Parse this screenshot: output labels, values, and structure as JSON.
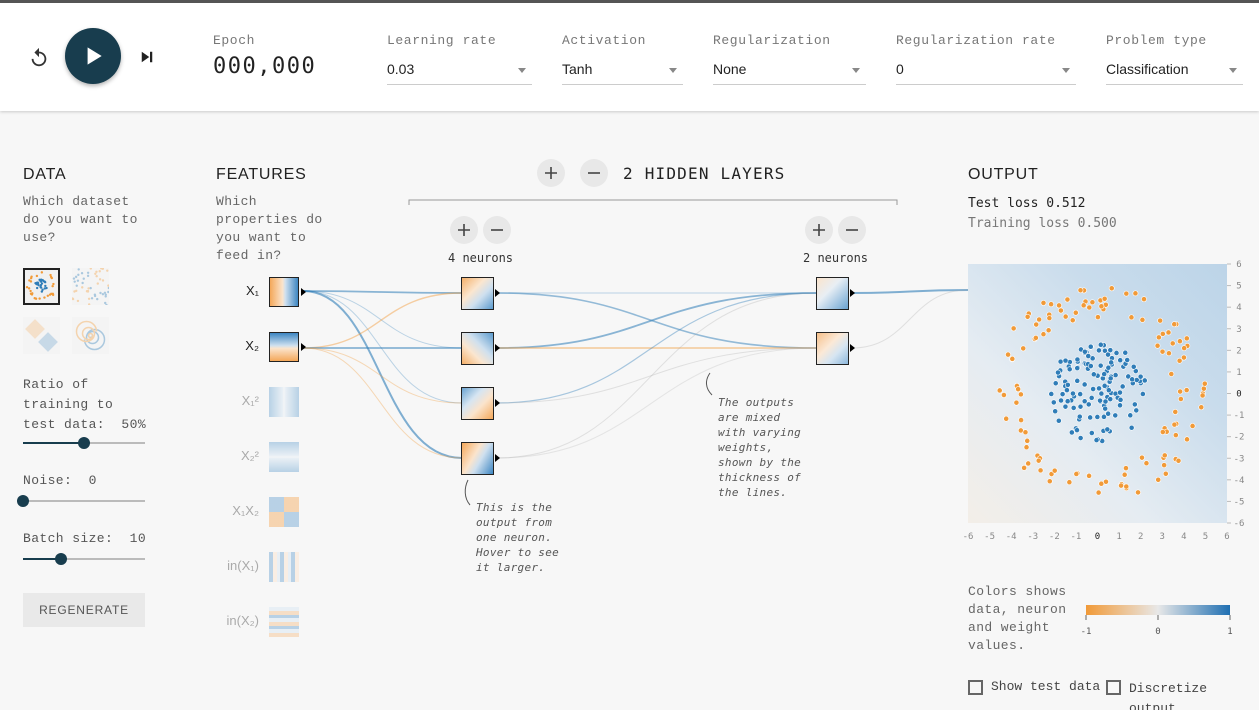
{
  "toolbar": {
    "epoch_label": "Epoch",
    "epoch_value": "000,000",
    "learning_rate": {
      "label": "Learning rate",
      "value": "0.03"
    },
    "activation": {
      "label": "Activation",
      "value": "Tanh"
    },
    "regularization": {
      "label": "Regularization",
      "value": "None"
    },
    "regularization_rate": {
      "label": "Regularization rate",
      "value": "0"
    },
    "problem_type": {
      "label": "Problem type",
      "value": "Classification"
    },
    "icons": {
      "reset": "reset-icon",
      "play": "play-icon",
      "step": "step-forward-icon"
    }
  },
  "data_panel": {
    "title": "DATA",
    "description": "Which dataset do you want to use?",
    "datasets": [
      "circle",
      "xor",
      "gaussian",
      "spiral"
    ],
    "selected_dataset": "circle",
    "ratio": {
      "label": "Ratio of training to test data:",
      "value": "50%",
      "fraction": 0.5
    },
    "noise": {
      "label": "Noise:",
      "value": "0",
      "fraction": 0.0
    },
    "batch": {
      "label": "Batch size:",
      "value": "10",
      "fraction": 0.31
    },
    "regenerate_label": "REGENERATE"
  },
  "features_panel": {
    "title": "FEATURES",
    "description": "Which properties do you want to feed in?",
    "features": [
      {
        "label": "X₁",
        "active": true
      },
      {
        "label": "X₂",
        "active": true
      },
      {
        "label": "X₁²",
        "active": false
      },
      {
        "label": "X₂²",
        "active": false
      },
      {
        "label": "X₁X₂",
        "active": false
      },
      {
        "label": "in(X₁)",
        "active": false
      },
      {
        "label": "in(X₂)",
        "active": false
      }
    ]
  },
  "network": {
    "hidden_layers_count": "2",
    "hidden_layers_label": "HIDDEN LAYERS",
    "layers": [
      {
        "neurons_label": "4 neurons",
        "neurons": 4
      },
      {
        "neurons_label": "2 neurons",
        "neurons": 2
      }
    ],
    "annotation_neuron": "This is the output from one neuron. Hover to see it larger.",
    "annotation_weights": "The outputs are mixed with varying weights, shown by the thickness of the lines."
  },
  "output_panel": {
    "title": "OUTPUT",
    "test_loss": "Test loss 0.512",
    "training_loss": "Training loss 0.500",
    "axis_ticks": [
      "-6",
      "-5",
      "-4",
      "-3",
      "-2",
      "-1",
      "0",
      "1",
      "2",
      "3",
      "4",
      "5",
      "6"
    ],
    "colors_desc": "Colors shows data, neuron and weight values.",
    "legend_ticks": [
      "-1",
      "0",
      "1"
    ],
    "show_test_data": {
      "label": "Show test data",
      "checked": false
    },
    "discretize": {
      "label": "Discretize output",
      "checked": false
    }
  },
  "colors": {
    "positive": "#2f7db8",
    "negative": "#f19a38",
    "accent": "#183d4e"
  }
}
